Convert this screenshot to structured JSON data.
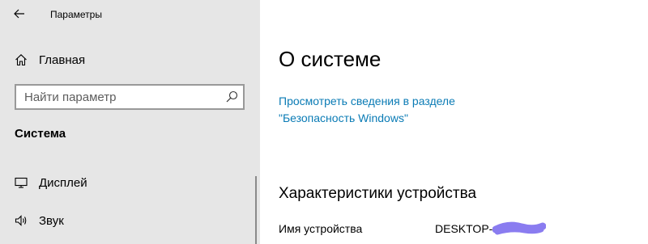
{
  "window": {
    "title": "Параметры"
  },
  "sidebar": {
    "home": {
      "label": "Главная",
      "icon": "home-icon"
    },
    "search": {
      "placeholder": "Найти параметр",
      "icon": "search-icon"
    },
    "section_heading": "Система",
    "items": [
      {
        "label": "Дисплей",
        "icon": "monitor-icon"
      },
      {
        "label": "Звук",
        "icon": "speaker-icon"
      }
    ]
  },
  "main": {
    "title": "О системе",
    "security_link": "Просмотреть сведения в разделе \"Безопасность Windows\"",
    "device_specs": {
      "heading": "Характеристики устройства",
      "device_name_label": "Имя устройства",
      "device_name_value": "DESKTOP-"
    }
  },
  "colors": {
    "sidebar_bg": "#e6e6e6",
    "link": "#0a7bb5",
    "redaction": "#8a7cf0"
  }
}
